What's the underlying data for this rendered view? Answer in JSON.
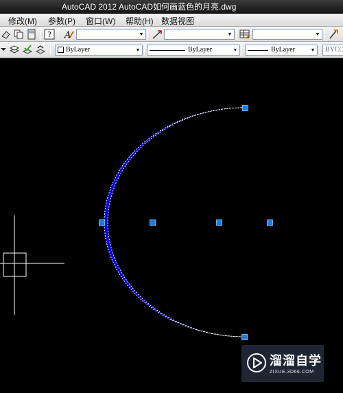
{
  "title": {
    "app": "AutoCAD 2012",
    "file": "AutoCAD如何画蓝色的月亮.dwg"
  },
  "menu": [
    {
      "label": "修改(M)"
    },
    {
      "label": "参数(P)"
    },
    {
      "label": "窗口(W)"
    },
    {
      "label": "帮助(H)"
    },
    {
      "label": "数据视图"
    }
  ],
  "properties": {
    "color": "ByLayer",
    "linetype": "ByLayer",
    "lineweight": "ByLayer",
    "plotstyle": "BYCOL"
  },
  "drawing": {
    "fill_color": "#0000ff",
    "background": "#000000",
    "grip_color": "#1e7fd8",
    "crosshair_color": "#ffffff"
  },
  "watermark": {
    "title": "溜溜自学",
    "subtitle": "ZIXUE.3D66.COM"
  }
}
